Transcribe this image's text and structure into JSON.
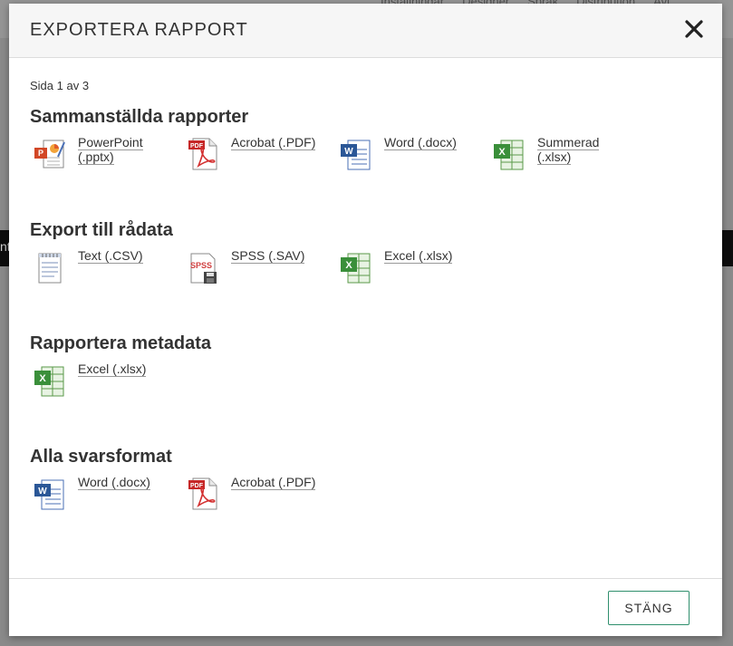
{
  "background": {
    "nav_items": [
      "Inställningar",
      "Designer",
      "Språk",
      "Distribution",
      "Avi"
    ],
    "dark_bar_text": "nt"
  },
  "dialog": {
    "title": "EXPORTERA RAPPORT",
    "close_symbol": "✕",
    "page_info": "Sida 1 av 3",
    "sections": [
      {
        "title": "Sammanställda rapporter",
        "items": [
          {
            "label": "PowerPoint\n(.pptx)",
            "icon": "powerpoint-icon"
          },
          {
            "label": "Acrobat (.PDF)",
            "icon": "pdf-icon"
          },
          {
            "label": "Word (.docx)",
            "icon": "word-icon"
          },
          {
            "label": "Summerad\n(.xlsx)",
            "icon": "excel-icon"
          }
        ]
      },
      {
        "title": "Export till rådata",
        "items": [
          {
            "label": "Text (.CSV)",
            "icon": "text-csv-icon"
          },
          {
            "label": "SPSS (.SAV)",
            "icon": "spss-icon"
          },
          {
            "label": "Excel (.xlsx)",
            "icon": "excel-icon"
          }
        ]
      },
      {
        "title": "Rapportera metadata",
        "items": [
          {
            "label": "Excel (.xlsx)",
            "icon": "excel-icon"
          }
        ]
      },
      {
        "title": "Alla svarsformat",
        "items": [
          {
            "label": "Word (.docx)",
            "icon": "word-icon"
          },
          {
            "label": "Acrobat (.PDF)",
            "icon": "pdf-icon"
          }
        ]
      }
    ],
    "footer_button": "STÄNG"
  },
  "colors": {
    "footer_button_border": "#2f8f6d",
    "excel_green": "#3a8f3a",
    "word_blue": "#2b5797",
    "pdf_red": "#d32f2f",
    "powerpoint_orange": "#d24726"
  }
}
